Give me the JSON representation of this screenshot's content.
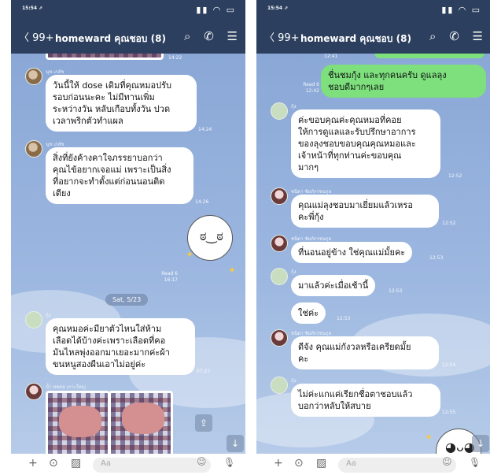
{
  "status": {
    "time": "15:54 ⇗",
    "icons": "▮▮ ◠ ▭"
  },
  "nav": {
    "back": "〈 99+",
    "title": "homeward คุณชอบ (8)",
    "search_glyph": "⌕",
    "call_glyph": "✆",
    "menu_glyph": "☰"
  },
  "input": {
    "placeholder": "Aa",
    "plus_glyph": "+",
    "camera_glyph": "⊙",
    "image_glyph": "▨",
    "emoji_glyph": "☺",
    "mic_glyph": "🎙"
  },
  "left": {
    "top_time": "14:22",
    "messages": [
      {
        "sender": "นุช เกลัช",
        "text": "วันนี้ให้ dose เดิมที่คุณหมอปรับ\nรอบก่อนนะคะ ไม่มีทานเพิ่ม\nระหว่างวัน หลับเกือบทั้งวัน ปวด\nเวลาพริกตัวทำแผล",
        "time": "14:24"
      },
      {
        "sender": "นุช เกลัช",
        "text": "สิ่งที่ยังค้างคาใจภรรยาบอกว่า\nคุณไข้อยากเจอแม่ เพราะเป็นสิ่ง\nที่อยากจะทำตั้งแต่ก่อนนอนติด\nเตียง",
        "time": "14:26"
      }
    ],
    "read": "Read 6\n16:17",
    "date": "Sat, 5/23",
    "messages2": [
      {
        "sender": "กุ้ง",
        "text": "คุณหมอค่ะมียาตัวไหนใส่ห้าม\nเลือดได้บ้างค่ะเพราะเลือดที่คอ\nมันไหลพุ่งออกมาเยอะมากค่ะผ้า\nขนหนูสองผืนเอาไม่อยู่ค่ะ",
        "time": "07:27"
      }
    ],
    "photo_sender": "น้ำ หพลล เกาะใหญ่"
  },
  "right": {
    "top_time": "12:41",
    "green": {
      "text": "ชื่นชมกุ้ง และทุกคนครับ ดูแลลุง\nชอบดีมากๆเลย",
      "read": "Read 6\n12:42"
    },
    "messages": [
      {
        "sender": "กุ้ง",
        "text": "ค่ะขอบคุณค่ะคุณหมอที่คอย\nให้การดูแลและรับปรึกษาอาการ\nของลุงชอบขอบคุณคุณหมอและ\nเจ้าหน้าที่ทุกท่านค่ะขอบคุณ\nมากๆ",
        "time": "12:52"
      },
      {
        "sender": "ชนิดา ชัยภักรชนกุล",
        "text": "คุณแม่ลุงชอบมาเยี่ยมแล้วเหรอ\nคะพี่กุ้ง",
        "time": "12:52"
      },
      {
        "sender": "ชนิดา ชัยภักรชนกุล",
        "text": "ที่นอนอยู่ข้าง ใช่คุณแม่มั้ยคะ",
        "time": "12:53"
      },
      {
        "sender": "กุ้ง",
        "text": "มาแล้วค่ะเมื่อเช้านี้",
        "time": "12:53"
      },
      {
        "sender": "",
        "text": "ใช่ค่ะ",
        "time": "12:53"
      },
      {
        "sender": "ชนิดา ชัยภักรชนกุล",
        "text": "ดีจัง คุณแม่กังวลหรือเครียดมั้ย\nคะ",
        "time": "12:54"
      },
      {
        "sender": "กุ้ง",
        "text": "ไม่ค่ะแกแค่เรียกชื่อตาชอบแล้ว\nบอกว่าหลับให้สบาย",
        "time": "12:55"
      }
    ]
  }
}
